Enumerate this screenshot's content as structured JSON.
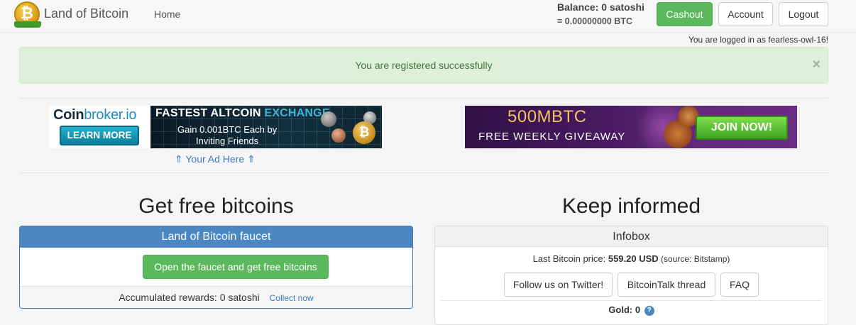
{
  "navbar": {
    "brand": "Land of Bitcoin",
    "home_label": "Home",
    "balance": "Balance: 0 satoshi",
    "balance_btc_prefix": "= ",
    "balance_btc_value": "0.00000000",
    "balance_btc_unit": " BTC",
    "cashout_label": "Cashout",
    "account_label": "Account",
    "logout_label": "Logout",
    "logged_in_text": "You are logged in as fearless-owl-16!"
  },
  "alert": {
    "message": "You are registered successfully",
    "close_glyph": "×"
  },
  "ads": {
    "coinbroker": {
      "name_part1": "Coin",
      "name_part2": "broker.io",
      "learn_more": "LEARN MORE",
      "headline_part1": "FASTEST ALTCOIN ",
      "headline_part2": "EXCHANGE",
      "gain_line1": "Gain 0.001BTC Each by",
      "gain_line2": "Inviting Friends",
      "coin_glyph": "₿"
    },
    "your_ad_here": "⇑ Your Ad Here ⇑",
    "giveaway": {
      "title": "500MBTC",
      "subtitle": "FREE WEEKLY GIVEAWAY",
      "join_label": "JOIN NOW!"
    }
  },
  "left_section": {
    "heading": "Get free bitcoins",
    "panel_title": "Land of Bitcoin faucet",
    "faucet_button": "Open the faucet and get free bitcoins",
    "rewards_text": "Accumulated rewards: 0 satoshi",
    "collect_link": "Collect now"
  },
  "right_section": {
    "heading": "Keep informed",
    "panel_title": "Infobox",
    "price_label": "Last Bitcoin price: ",
    "price_value": "559.20 USD",
    "price_source": " (source: Bitstamp)",
    "twitter_button": "Follow us on Twitter!",
    "bitcointalk_button": "BitcoinTalk thread",
    "faq_button": "FAQ",
    "gold_text": "Gold: 0",
    "help_glyph": "?"
  },
  "colors": {
    "success": "#5cb85c",
    "primary": "#4a87c3",
    "alert_bg": "#dff0d8",
    "alert_text": "#3c763d",
    "link": "#3a7bbf"
  }
}
